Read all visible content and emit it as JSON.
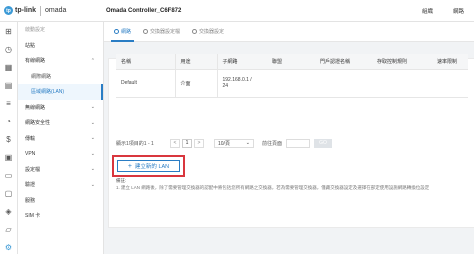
{
  "brand": {
    "logo_glyph": "tp",
    "name": "tp-link",
    "product": "omada"
  },
  "header": {
    "title": "Omada Controller_C6F872",
    "right": [
      "組織",
      "網路"
    ]
  },
  "icon_rail": [
    "grid-icon",
    "clock-icon",
    "map-icon",
    "chart-icon",
    "list-icon",
    "gauge-icon",
    "dollar-icon",
    "lock-icon",
    "file-icon",
    "desktop-icon",
    "shield-icon",
    "chat-icon",
    "gear-icon"
  ],
  "sidenav": {
    "items": [
      {
        "label": "啟動設定",
        "kind": "muted"
      },
      {
        "label": "站點",
        "kind": "top"
      },
      {
        "label": "有線網路",
        "kind": "parent",
        "chev": "⌃"
      },
      {
        "label": "網際網路",
        "kind": "sub"
      },
      {
        "label": "區域網路(LAN)",
        "kind": "current"
      },
      {
        "label": "無線網路",
        "kind": "top",
        "chev": "⌄"
      },
      {
        "label": "網路安全性",
        "kind": "top",
        "chev": "⌄"
      },
      {
        "label": "傳輸",
        "kind": "top",
        "chev": "⌄"
      },
      {
        "label": "VPN",
        "kind": "top",
        "chev": "⌄"
      },
      {
        "label": "設定檔",
        "kind": "top",
        "chev": "⌄"
      },
      {
        "label": "驗證",
        "kind": "top",
        "chev": "⌄"
      },
      {
        "label": "服務",
        "kind": "top"
      },
      {
        "label": "SIM 卡",
        "kind": "top"
      }
    ]
  },
  "tabs": [
    {
      "label": "網路",
      "active": true
    },
    {
      "label": "交換器設定檔",
      "active": false
    },
    {
      "label": "交換器設定",
      "active": false
    }
  ],
  "table": {
    "headers": [
      "名稱",
      "用途",
      "子網路",
      "聯盟",
      "門戶認證名稱",
      "存取控制規則",
      "速率限制"
    ],
    "rows": [
      {
        "name": "Default",
        "purpose": "介面",
        "subnet_line1": "192.168.0.1 /",
        "subnet_line2": "24",
        "vlan": "",
        "portal": "",
        "acl": "",
        "rate": ""
      }
    ]
  },
  "pager": {
    "summary": "顯示1項目的1 - 1",
    "prev": "<",
    "page": "1",
    "next": ">",
    "per_page": "10/頁",
    "goto_label": "前往頁面",
    "go_button": "GO"
  },
  "add_button": {
    "icon": "+",
    "label": "建立新的 LAN"
  },
  "note": {
    "label": "備註:",
    "text": "1. 建立 LAN 網路後，除了需要管理交換器的認配中將包括您所有網路之交換器，若為需要管理交換器，僅藏交換器設定及選擇在部定使用設施網路轉換位設定"
  },
  "colors": {
    "accent": "#2a7dc4",
    "highlight_border": "#d9363e"
  }
}
